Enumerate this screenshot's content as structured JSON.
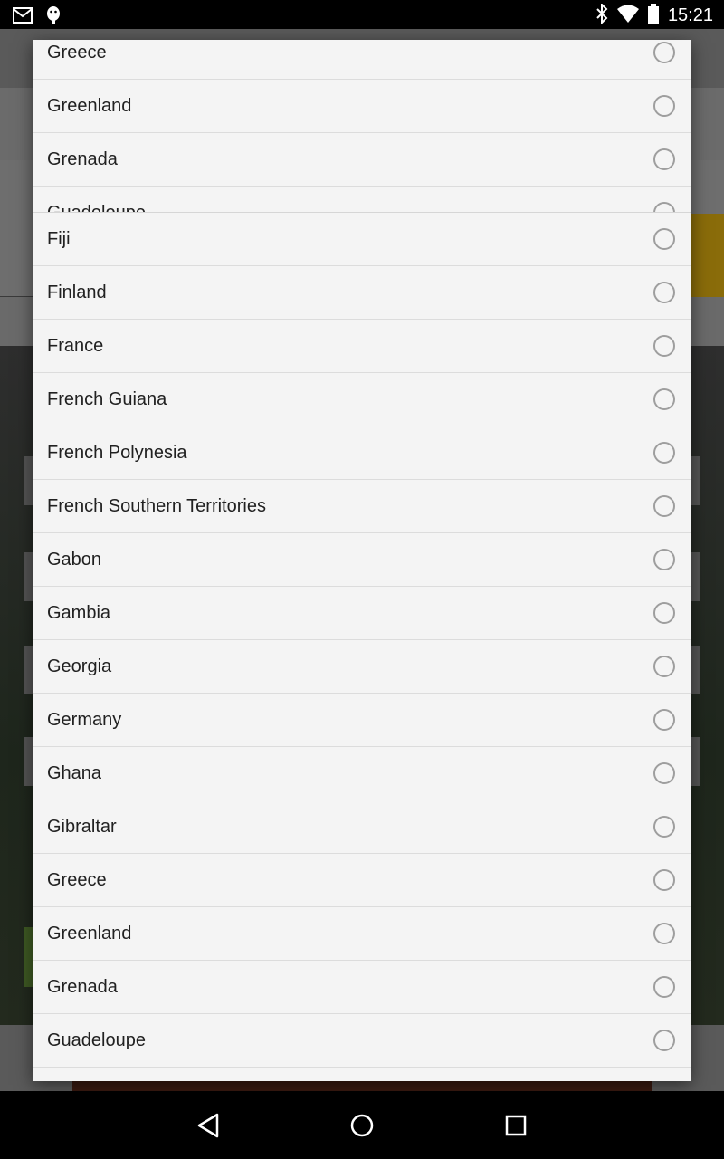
{
  "status_bar": {
    "time": "15:21",
    "left_icons": [
      "gmail-icon",
      "android-debug-icon"
    ],
    "right_icons": [
      "bluetooth-icon",
      "wifi-icon",
      "battery-icon"
    ]
  },
  "dialog": {
    "partially_hidden_list": [
      "Greece",
      "Greenland",
      "Grenada",
      "Guadeloupe"
    ],
    "countries": [
      "Fiji",
      "Finland",
      "France",
      "French Guiana",
      "French Polynesia",
      "French Southern Territories",
      "Gabon",
      "Gambia",
      "Georgia",
      "Germany",
      "Ghana",
      "Gibraltar",
      "Greece",
      "Greenland",
      "Grenada",
      "Guadeloupe"
    ]
  },
  "nav_bar": {
    "buttons": [
      "back-icon",
      "home-icon",
      "recents-icon"
    ]
  }
}
